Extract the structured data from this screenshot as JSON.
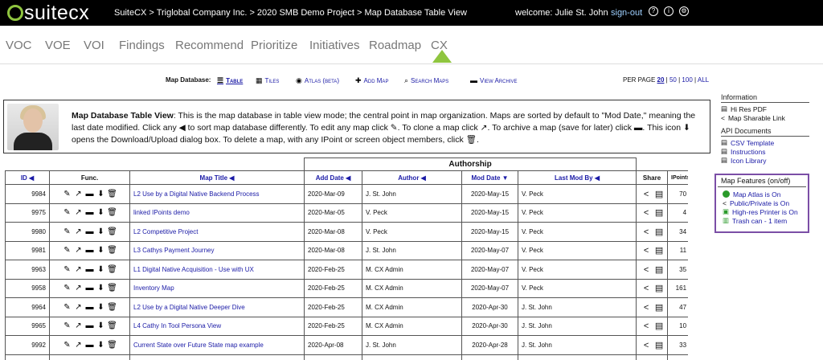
{
  "topbar": {
    "logo": "suitecx",
    "breadcrumb": "SuiteCX > Triglobal Company Inc. > 2020 SMB Demo Project > Map Database Table View",
    "welcome_prefix": "welcome:",
    "user_name": "Julie St. John",
    "signout": "sign-out",
    "icons": [
      "help-icon",
      "accessibility-icon",
      "settings-icon"
    ]
  },
  "nav": {
    "items": [
      "VOC",
      "VOE",
      "VOI",
      "Findings",
      "Recommend",
      "Prioritize",
      "Initiatives",
      "Roadmap",
      "CX"
    ],
    "active": "CX",
    "accent": "#8fc53f"
  },
  "toolbar": {
    "label": "Map Database:",
    "table": "Table",
    "tiles": "Tiles",
    "atlas": "Atlas (βeta)",
    "add_map": "Add Map",
    "search_maps": "Search Maps",
    "view_archive": "View Archive",
    "per_page_label": "PER PAGE",
    "per_page_options": [
      "20",
      "50",
      "100",
      "ALL"
    ]
  },
  "help": {
    "title": "Map Database Table View",
    "text": ": This is the map database in table view mode; the central point in map organization. Maps are sorted by default to \"Mod Date,\" meaning the last date modified. Click any ◀ to sort map database differently. To edit any map click ✎. To clone a map click ↗. To archive a map (save for later) click ▬. This icon ⬇ opens the Download/Upload dialog box. To delete a map, with any IPoint or screen object members, click 🗑."
  },
  "table": {
    "group_header": "Authorship",
    "columns": {
      "id": "ID ◀",
      "func": "Func.",
      "title": "Map Title ◀",
      "add_date": "Add Date ◀",
      "author": "Author ◀",
      "mod_date": "Mod Date ▼",
      "last_mod": "Last Mod By ◀",
      "share": "Share",
      "ipoints": "IPoints"
    },
    "rows": [
      {
        "id": "9984",
        "title": "L2 Use by a Digital Native Backend Process",
        "add_date": "2020-Mar-09",
        "author": "J. St. John",
        "mod_date": "2020-May-15",
        "last_mod": "V. Peck",
        "ipoints": "70"
      },
      {
        "id": "9975",
        "title": "linked IPoints demo",
        "add_date": "2020-Mar-05",
        "author": "V. Peck",
        "mod_date": "2020-May-15",
        "last_mod": "V. Peck",
        "ipoints": "4"
      },
      {
        "id": "9980",
        "title": "L2 Competitive Project",
        "add_date": "2020-Mar-08",
        "author": "V. Peck",
        "mod_date": "2020-May-15",
        "last_mod": "V. Peck",
        "ipoints": "34"
      },
      {
        "id": "9981",
        "title": "L3 Cathys Payment Journey",
        "add_date": "2020-Mar-08",
        "author": "J. St. John",
        "mod_date": "2020-May-07",
        "last_mod": "V. Peck",
        "ipoints": "11"
      },
      {
        "id": "9963",
        "title": "L1 Digital Native Acquisition - Use with UX",
        "add_date": "2020-Feb-25",
        "author": "M. CX Admin",
        "mod_date": "2020-May-07",
        "last_mod": "V. Peck",
        "ipoints": "35"
      },
      {
        "id": "9958",
        "title": "Inventory Map",
        "add_date": "2020-Feb-25",
        "author": "M. CX Admin",
        "mod_date": "2020-May-07",
        "last_mod": "V. Peck",
        "ipoints": "161"
      },
      {
        "id": "9964",
        "title": "L2 Use by a Digital Native Deeper Dive",
        "add_date": "2020-Feb-25",
        "author": "M. CX Admin",
        "mod_date": "2020-Apr-30",
        "last_mod": "J. St. John",
        "ipoints": "47"
      },
      {
        "id": "9965",
        "title": "L4 Cathy In Tool Persona View",
        "add_date": "2020-Feb-25",
        "author": "M. CX Admin",
        "mod_date": "2020-Apr-30",
        "last_mod": "J. St. John",
        "ipoints": "10"
      },
      {
        "id": "9992",
        "title": "Current State over Future State map example",
        "add_date": "2020-Apr-08",
        "author": "J. St. John",
        "mod_date": "2020-Apr-28",
        "last_mod": "J. St. John",
        "ipoints": "33"
      },
      {
        "id": "",
        "title": "",
        "add_date": "",
        "author": "",
        "mod_date": "",
        "last_mod": "",
        "ipoints": ""
      }
    ]
  },
  "sidebar": {
    "information_title": "Information",
    "information_items": [
      "Hi Res PDF",
      "Map Sharable Link"
    ],
    "api_title": "API Documents",
    "api_items": [
      "CSV Template",
      "Instructions",
      "Icon Library"
    ],
    "features_title": "Map Features (on/off)",
    "features": [
      "Map Atlas is On",
      "Public/Private is On",
      "High-res Printer is On",
      "Trash can - 1 item"
    ]
  }
}
